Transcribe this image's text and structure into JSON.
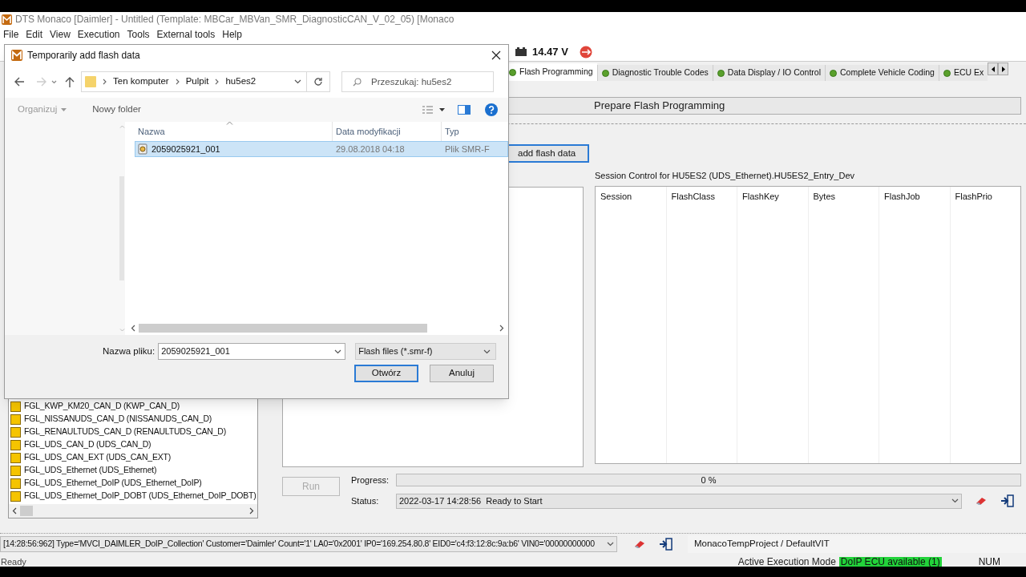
{
  "window": {
    "title": "DTS Monaco [Daimler] - Untitled (Template: MBCar_MBVan_SMR_DiagnosticCAN_V_02_05) [Monaco"
  },
  "menu": [
    "File",
    "Edit",
    "View",
    "Execution",
    "Tools",
    "External tools",
    "Help"
  ],
  "voltage": "14.47 V",
  "tabs": [
    {
      "label": "Flash Programming",
      "selected": true
    },
    {
      "label": "Diagnostic Trouble Codes",
      "selected": false
    },
    {
      "label": "Data Display / IO Control",
      "selected": false
    },
    {
      "label": "Complete Vehicle Coding",
      "selected": false
    },
    {
      "label": "ECU Ex",
      "selected": false
    }
  ],
  "prepare_button": "Prepare Flash Programming",
  "add_flash_button": "add flash data",
  "session": {
    "title": "Session Control for HU5ES2 (UDS_Ethernet).HU5ES2_Entry_Dev",
    "columns": [
      "Session",
      "FlashClass",
      "FlashKey",
      "Bytes",
      "FlashJob",
      "FlashPrio"
    ]
  },
  "tree_items": [
    "FGL_KWP_KM20_CAN_D (KWP_CAN_D)",
    "FGL_NISSANUDS_CAN_D (NISSANUDS_CAN_D)",
    "FGL_RENAULTUDS_CAN_D (RENAULTUDS_CAN_D)",
    "FGL_UDS_CAN_D (UDS_CAN_D)",
    "FGL_UDS_CAN_EXT (UDS_CAN_EXT)",
    "FGL_UDS_Ethernet (UDS_Ethernet)",
    "FGL_UDS_Ethernet_DoIP (UDS_Ethernet_DoIP)",
    "FGL_UDS_Ethernet_DoIP_DOBT (UDS_Ethernet_DoIP_DOBT)"
  ],
  "run_button": {
    "label": "Run",
    "disabled": true
  },
  "progress": {
    "label": "Progress:",
    "level": 0,
    "reading": "0 %"
  },
  "status": {
    "label": "Status:",
    "value": "2022-03-17 14:28:56  Ready to Start"
  },
  "log": "[14:28:56:962] Type='MVCI_DAIMLER_DoIP_Collection' Customer='Daimler' Count='1' LA0='0x2001' IP0='169.254.80.8' EID0='c4:f3:12:8c:9a:b6' VIN0='00000000000",
  "project": "MonacoTempProject / DefaultVIT",
  "status_bar": {
    "left": "Ready",
    "mode_label": "Active Execution Mode",
    "mode_value": "DoIP ECU available (1)",
    "num": "NUM"
  },
  "dialog": {
    "title": "Temporarily add flash data",
    "breadcrumb": [
      "Ten komputer",
      "Pulpit",
      "hu5es2"
    ],
    "search_placeholder": "Przeszukaj: hu5es2",
    "organize": {
      "label": "Organizuj",
      "disabled": true
    },
    "new_folder": "Nowy folder",
    "columns": [
      "Nazwa",
      "Data modyfikacji",
      "Typ"
    ],
    "files": [
      {
        "name": "2059025921_001",
        "date": "29.08.2018 04:18",
        "type": "Plik SMR-F",
        "selected": true
      }
    ],
    "filename_label": "Nazwa pliku:",
    "filename": "2059025921_001",
    "filter": "Flash files (*.smr-f)",
    "open_button": "Otwórz",
    "cancel_button": "Anuluj"
  }
}
